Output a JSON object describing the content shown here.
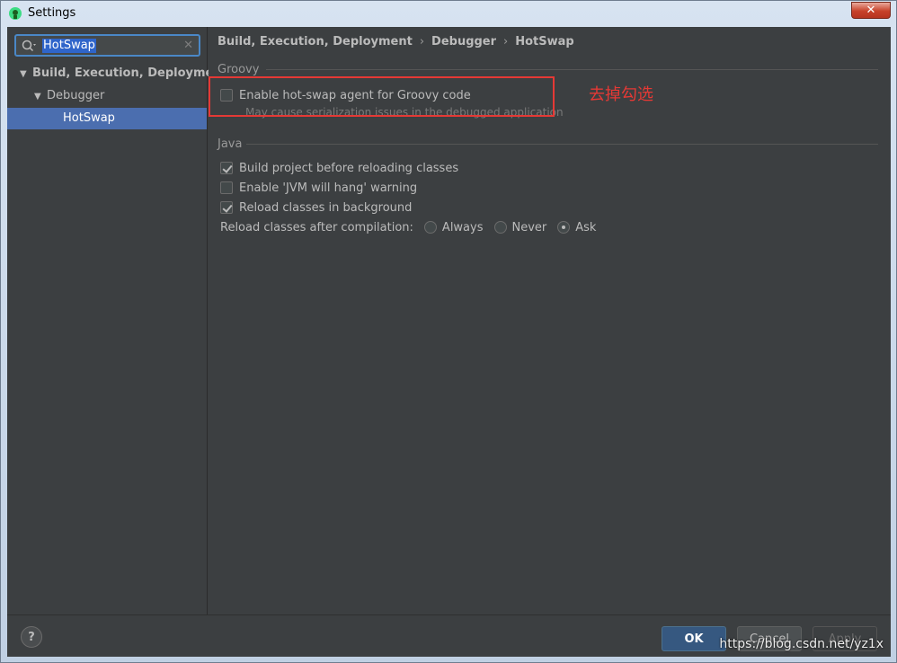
{
  "window": {
    "title": "Settings",
    "close_label": "✕"
  },
  "sidebar": {
    "search_value": "HotSwap",
    "tree": [
      {
        "label": "Build, Execution, Deployment"
      },
      {
        "label": "Debugger"
      },
      {
        "label": "HotSwap"
      }
    ]
  },
  "breadcrumb": [
    "Build, Execution, Deployment",
    "Debugger",
    "HotSwap"
  ],
  "groovy": {
    "section": "Groovy",
    "option_label": "Enable hot-swap agent for Groovy code",
    "option_checked": false,
    "hint": "May cause serialization issues in the debugged application"
  },
  "java": {
    "section": "Java",
    "options": [
      {
        "label": "Build project before reloading classes",
        "checked": true
      },
      {
        "label": "Enable 'JVM will hang' warning",
        "checked": false
      },
      {
        "label": "Reload classes in background",
        "checked": true
      }
    ],
    "reload_label": "Reload classes after compilation:",
    "radios": [
      {
        "label": "Always",
        "selected": false
      },
      {
        "label": "Never",
        "selected": false
      },
      {
        "label": "Ask",
        "selected": true
      }
    ]
  },
  "annotation": "去掉勾选",
  "footer": {
    "help": "?",
    "ok": "OK",
    "cancel": "Cancel",
    "apply": "Apply",
    "watermark": "https://blog.csdn.net/yz1x"
  },
  "colors": {
    "accent": "#4b6eaf",
    "annotation": "#e53935",
    "background": "#3c3f41"
  }
}
